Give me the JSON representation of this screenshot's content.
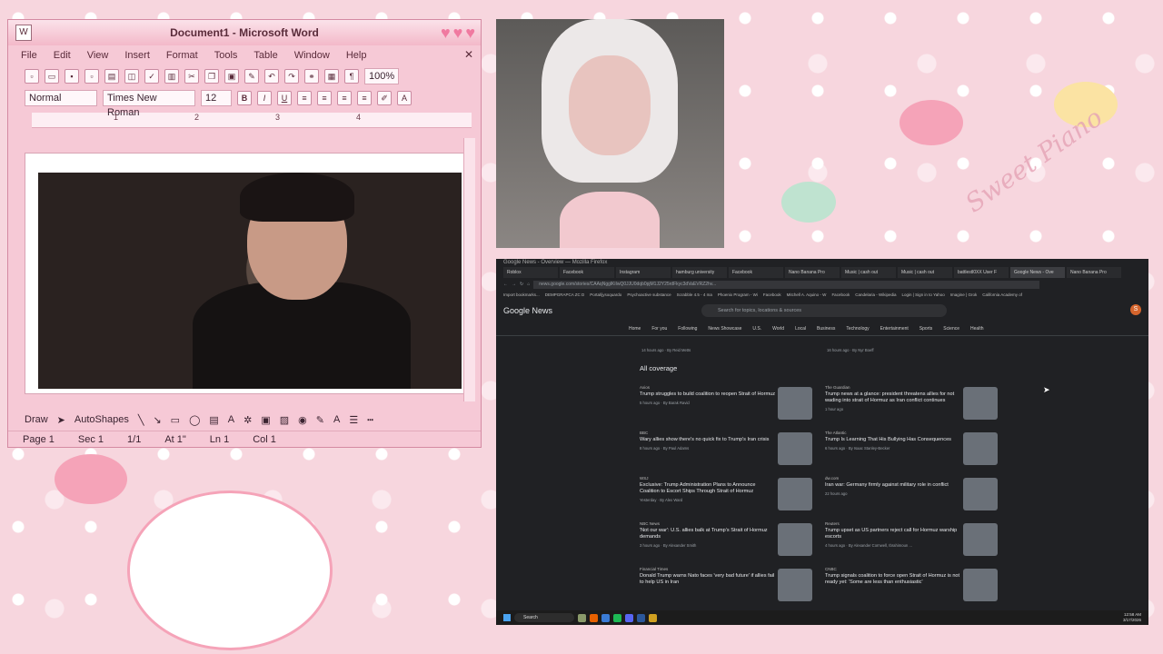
{
  "word": {
    "title": "Document1 - Microsoft Word",
    "menu": [
      "File",
      "Edit",
      "View",
      "Insert",
      "Format",
      "Tools",
      "Table",
      "Window",
      "Help"
    ],
    "zoom": "100%",
    "style": "Normal",
    "font": "Times New Roman",
    "size": "12",
    "ruler_marks": [
      "1",
      "2",
      "3",
      "4"
    ],
    "draw_label": "Draw",
    "autoshapes_label": "AutoShapes",
    "status": {
      "page": "Page 1",
      "sec": "Sec 1",
      "count": "1/1",
      "at": "At 1\"",
      "ln": "Ln 1",
      "col": "Col 1"
    }
  },
  "browser": {
    "window_title": "Google News - Overview — Mozilla Firefox",
    "tabs": [
      "Roblox",
      "Facebook",
      "Instagram",
      "hamburg university",
      "Facebook",
      "Nano Banana Pro",
      "Music | cash out",
      "Music | cash out",
      "battlestl0XX User F",
      "Google News - Ove",
      "Nano Banana Pro"
    ],
    "active_tab": 9,
    "url": "news.google.com/stories/CAAqNgglKiIwQ0JJU0dqb0pjM1J2Y25rdFkyc3dVaEVRZ2hv...",
    "bookmarks": [
      "Import bookmarks...",
      "DEMPGRAPCA ZC D",
      "Portal/jysoquardo",
      "Psychoactive substance",
      "Scrabble 4.5 - 4 ma",
      "Phoenix Program - Wi",
      "Facebook",
      "Mitchell A. Aquino - W",
      "Facebook",
      "Candelaria - Wikipedia",
      "Login | Sign in to Yahoo",
      "Imagine | Grok",
      "California Academy of"
    ],
    "logo": "Google News",
    "search_placeholder": "Search for topics, locations & sources",
    "avatar_letter": "S",
    "topics": [
      "Home",
      "For you",
      "Following",
      "News Showcase",
      "U.S.",
      "World",
      "Local",
      "Business",
      "Technology",
      "Entertainment",
      "Sports",
      "Science",
      "Health"
    ],
    "all_coverage": "All coverage",
    "top_left_meta": "14 hours ago · By Reid Metts",
    "top_right_meta": "16 hours ago · By Nyr Boeff",
    "articles": [
      {
        "source": "Axios",
        "headline": "Trump struggles to build coalition to reopen Strait of Hormuz",
        "meta": "5 hours ago · By Barak Ravid"
      },
      {
        "source": "The Guardian",
        "headline": "Trump news at a glance: president threatens allies for not wading into strait of Hormuz as Iran conflict continues",
        "meta": "1 hour ago"
      },
      {
        "source": "BBC",
        "headline": "Wary allies show there's no quick fix to Trump's Iran crisis",
        "meta": "8 hours ago · By Paul Adams"
      },
      {
        "source": "The Atlantic",
        "headline": "Trump Is Learning That His Bullying Has Consequences",
        "meta": "6 hours ago · By Isaac Stanley-Becker"
      },
      {
        "source": "WSJ",
        "headline": "Exclusive: Trump Administration Plans to Announce Coalition to Escort Ships Through Strait of Hormuz",
        "meta": "Yesterday · By Alex Ward"
      },
      {
        "source": "dw.com",
        "headline": "Iran war: Germany firmly against military role in conflict",
        "meta": "22 hours ago"
      },
      {
        "source": "NBC News",
        "headline": "'Not our war': U.S. allies balk at Trump's Strait of Hormuz demands",
        "meta": "3 hours ago · By Alexander Smith"
      },
      {
        "source": "Reuters",
        "headline": "Trump upset as US partners reject call for Hormuz warship escorts",
        "meta": "4 hours ago · By Alexander Cornwell, Ibrahimoun ..."
      },
      {
        "source": "Financial Times",
        "headline": "Donald Trump warns Nato faces 'very bad future' if allies fail to help US in Iran",
        "meta": ""
      },
      {
        "source": "CNBC",
        "headline": "Trump signals coalition to force open Strait of Hormuz is not ready yet: 'Some are less than enthusiastic'",
        "meta": ""
      }
    ]
  },
  "taskbar": {
    "search": "Search",
    "time": "12:58 AM",
    "date": "3/17/2026"
  },
  "signature": "Sweet Piano"
}
